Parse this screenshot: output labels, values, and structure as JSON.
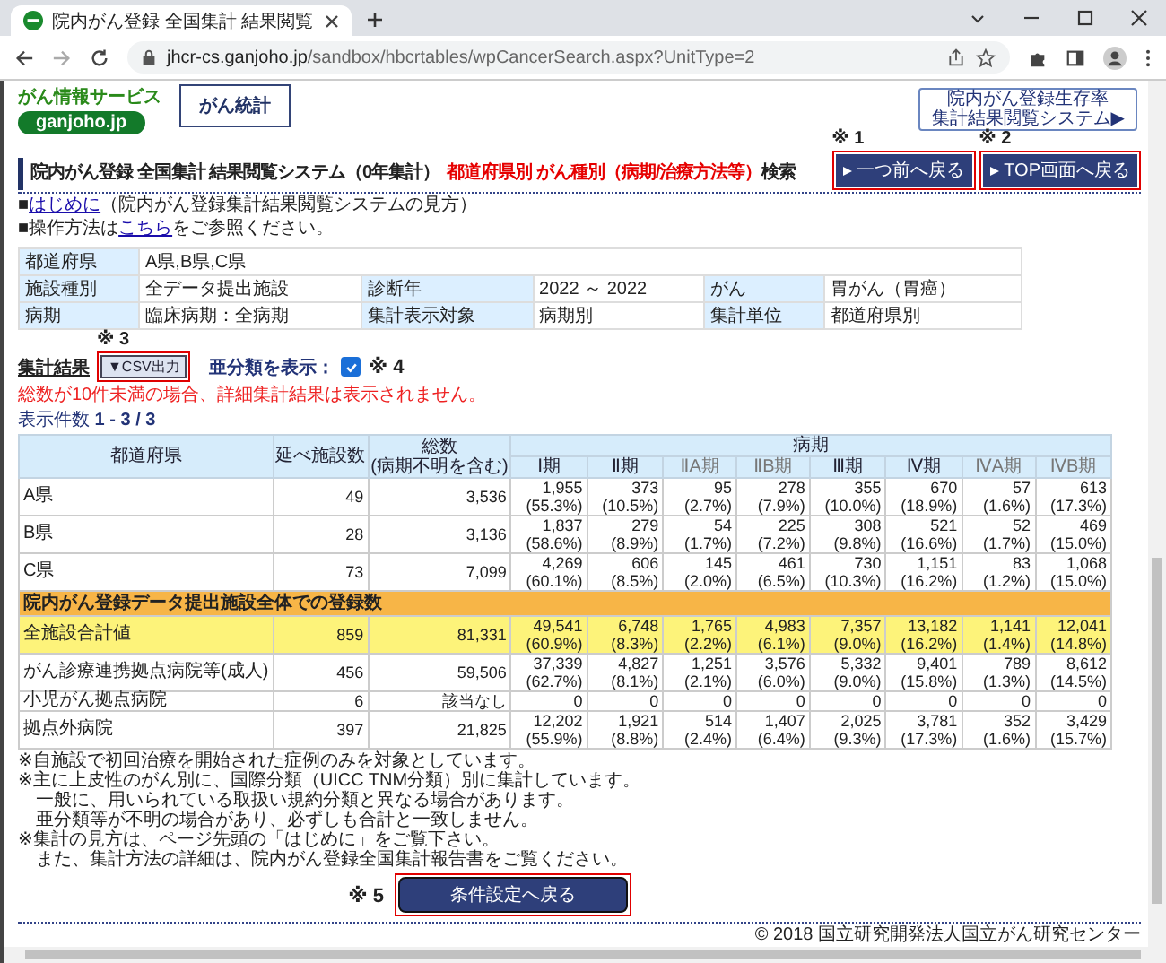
{
  "browser": {
    "tab_title": "院内がん登録 全国集計 結果閲覧",
    "url_host": "jhcr-cs.ganjoho.jp",
    "url_path": "/sandbox/hbcrtables/wpCancerSearch.aspx?UnitType=2"
  },
  "header": {
    "service_label": "がん情報サービス",
    "logo": "ganjoho.jp",
    "nav_button": "がん統計",
    "survival_link": {
      "title": "院内がん登録生存率",
      "subtitle": "集計結果閲覧システム▶"
    }
  },
  "title": {
    "main": "院内がん登録 全国集計 結果閲覧システム（0年集計）",
    "highlight": "都道府県別 がん種別（病期/治療方法等）",
    "suffix": "検索"
  },
  "nav_buttons": [
    {
      "mark": "※ 1",
      "label": "一つ前へ戻る",
      "outlined": true
    },
    {
      "mark": "※ 2",
      "label": "TOP画面へ戻る",
      "outlined": true
    }
  ],
  "info_lines": [
    {
      "before": "■",
      "link": "はじめに",
      "after": "（院内がん登録集計結果閲覧システムの見方）"
    },
    {
      "before": "■操作方法は",
      "link": "こちら",
      "after": "をご参照ください。"
    }
  ],
  "conditions": [
    [
      {
        "label": "都道府県",
        "value": "A県,B県,C県"
      }
    ],
    [
      {
        "label": "施設種別",
        "value": "全データ提出施設"
      },
      {
        "label": "診断年",
        "value": "2022 ～ 2022"
      },
      {
        "label": "がん",
        "value": "胃がん（胃癌）"
      }
    ],
    [
      {
        "label": "病期",
        "value": "臨床病期：全病期"
      },
      {
        "label": "集計表示対象",
        "value": "病期別"
      },
      {
        "label": "集計単位",
        "value": "都道府県別"
      }
    ]
  ],
  "results": {
    "label": "集計結果",
    "csv": {
      "mark": "※ 3",
      "label": "▼CSV出力",
      "outlined": true
    },
    "subclass": {
      "label": "亜分類を表示：",
      "checked": true,
      "mark": "※ 4"
    },
    "warning": "総数が10件未満の場合、詳細集計結果は表示されません。",
    "count_label": "表示件数",
    "count": "1 - 3 / 3"
  },
  "table": {
    "columns": {
      "region": "都道府県",
      "facilities": "延べ施設数",
      "total": "総数",
      "total_note": "(病期不明を含む)",
      "stage_group": "病期",
      "stages": [
        {
          "label": "Ⅰ期",
          "kind": "main"
        },
        {
          "label": "Ⅱ期",
          "kind": "main"
        },
        {
          "label": "ⅡA期",
          "kind": "sub"
        },
        {
          "label": "ⅡB期",
          "kind": "sub"
        },
        {
          "label": "Ⅲ期",
          "kind": "main"
        },
        {
          "label": "Ⅳ期",
          "kind": "main"
        },
        {
          "label": "ⅣA期",
          "kind": "sub"
        },
        {
          "label": "ⅣB期",
          "kind": "sub"
        }
      ]
    },
    "rows": [
      {
        "kind": "data",
        "name": "A県",
        "facilities": "49",
        "total": "3,536",
        "highlighted": false,
        "cells": [
          {
            "n": "1,955",
            "pct": "(55.3%)"
          },
          {
            "n": "373",
            "pct": "(10.5%)"
          },
          {
            "n": "95",
            "pct": "(2.7%)"
          },
          {
            "n": "278",
            "pct": "(7.9%)"
          },
          {
            "n": "355",
            "pct": "(10.0%)"
          },
          {
            "n": "670",
            "pct": "(18.9%)"
          },
          {
            "n": "57",
            "pct": "(1.6%)"
          },
          {
            "n": "613",
            "pct": "(17.3%)"
          }
        ]
      },
      {
        "kind": "data",
        "name": "B県",
        "facilities": "28",
        "total": "3,136",
        "highlighted": false,
        "cells": [
          {
            "n": "1,837",
            "pct": "(58.6%)"
          },
          {
            "n": "279",
            "pct": "(8.9%)"
          },
          {
            "n": "54",
            "pct": "(1.7%)"
          },
          {
            "n": "225",
            "pct": "(7.2%)"
          },
          {
            "n": "308",
            "pct": "(9.8%)"
          },
          {
            "n": "521",
            "pct": "(16.6%)"
          },
          {
            "n": "52",
            "pct": "(1.7%)"
          },
          {
            "n": "469",
            "pct": "(15.0%)"
          }
        ]
      },
      {
        "kind": "data",
        "name": "C県",
        "facilities": "73",
        "total": "7,099",
        "highlighted": false,
        "cells": [
          {
            "n": "4,269",
            "pct": "(60.1%)"
          },
          {
            "n": "606",
            "pct": "(8.5%)"
          },
          {
            "n": "145",
            "pct": "(2.0%)"
          },
          {
            "n": "461",
            "pct": "(6.5%)"
          },
          {
            "n": "730",
            "pct": "(10.3%)"
          },
          {
            "n": "1,151",
            "pct": "(16.2%)"
          },
          {
            "n": "83",
            "pct": "(1.2%)"
          },
          {
            "n": "1,068",
            "pct": "(15.0%)"
          }
        ]
      },
      {
        "kind": "section",
        "name": "院内がん登録データ提出施設全体での登録数"
      },
      {
        "kind": "data",
        "name": "全施設合計値",
        "facilities": "859",
        "total": "81,331",
        "highlighted": true,
        "cells": [
          {
            "n": "49,541",
            "pct": "(60.9%)"
          },
          {
            "n": "6,748",
            "pct": "(8.3%)"
          },
          {
            "n": "1,765",
            "pct": "(2.2%)"
          },
          {
            "n": "4,983",
            "pct": "(6.1%)"
          },
          {
            "n": "7,357",
            "pct": "(9.0%)"
          },
          {
            "n": "13,182",
            "pct": "(16.2%)"
          },
          {
            "n": "1,141",
            "pct": "(1.4%)"
          },
          {
            "n": "12,041",
            "pct": "(14.8%)"
          }
        ]
      },
      {
        "kind": "data",
        "name": "がん診療連携拠点病院等(成人)",
        "facilities": "456",
        "total": "59,506",
        "highlighted": false,
        "cells": [
          {
            "n": "37,339",
            "pct": "(62.7%)"
          },
          {
            "n": "4,827",
            "pct": "(8.1%)"
          },
          {
            "n": "1,251",
            "pct": "(2.1%)"
          },
          {
            "n": "3,576",
            "pct": "(6.0%)"
          },
          {
            "n": "5,332",
            "pct": "(9.0%)"
          },
          {
            "n": "9,401",
            "pct": "(15.8%)"
          },
          {
            "n": "789",
            "pct": "(1.3%)"
          },
          {
            "n": "8,612",
            "pct": "(14.5%)"
          }
        ]
      },
      {
        "kind": "data",
        "name": "小児がん拠点病院",
        "facilities": "6",
        "total": "該当なし",
        "highlighted": false,
        "cells": [
          {
            "n": "0"
          },
          {
            "n": "0"
          },
          {
            "n": "0"
          },
          {
            "n": "0"
          },
          {
            "n": "0"
          },
          {
            "n": "0"
          },
          {
            "n": "0"
          },
          {
            "n": "0"
          }
        ]
      },
      {
        "kind": "data",
        "name": "拠点外病院",
        "facilities": "397",
        "total": "21,825",
        "highlighted": false,
        "cells": [
          {
            "n": "12,202",
            "pct": "(55.9%)"
          },
          {
            "n": "1,921",
            "pct": "(8.8%)"
          },
          {
            "n": "514",
            "pct": "(2.4%)"
          },
          {
            "n": "1,407",
            "pct": "(6.4%)"
          },
          {
            "n": "2,025",
            "pct": "(9.3%)"
          },
          {
            "n": "3,781",
            "pct": "(17.3%)"
          },
          {
            "n": "352",
            "pct": "(1.6%)"
          },
          {
            "n": "3,429",
            "pct": "(15.7%)"
          }
        ]
      }
    ]
  },
  "notes": [
    {
      "kind": "note",
      "text": "※自施設で初回治療を開始された症例のみを対象としています。"
    },
    {
      "kind": "note",
      "text": "※主に上皮性のがん別に、国際分類（UICC TNM分類）別に集計しています。"
    },
    {
      "kind": "continuation",
      "text": "一般に、用いられている取扱い規約分類と異なる場合があります。"
    },
    {
      "kind": "continuation",
      "text": "亜分類等が不明の場合があり、必ずしも合計と一致しません。"
    },
    {
      "kind": "note",
      "text": "※集計の見方は、ページ先頭の「はじめに」をご覧下さい。"
    },
    {
      "kind": "continuation",
      "text": "また、集計方法の詳細は、院内がん登録全国集計報告書をご覧ください。"
    }
  ],
  "bottom": {
    "mark": "※ 5",
    "button": "条件設定へ戻る",
    "outlined": true
  },
  "footer": "© 2018 国立研究開発法人国立がん研究センター"
}
